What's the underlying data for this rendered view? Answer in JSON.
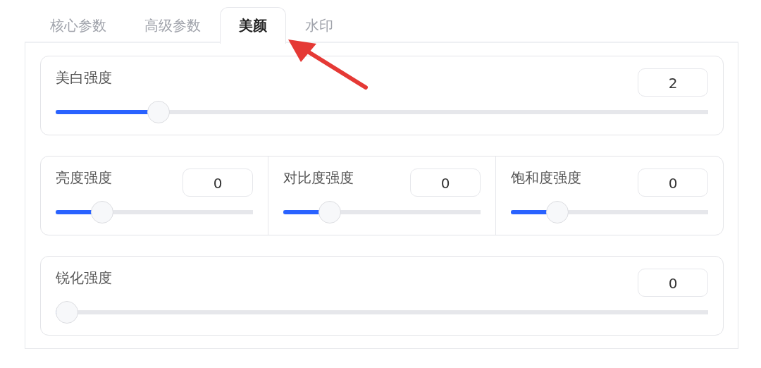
{
  "tabs": [
    {
      "label": "核心参数",
      "selected": false
    },
    {
      "label": "高级参数",
      "selected": false
    },
    {
      "label": "美颜",
      "selected": true
    },
    {
      "label": "水印",
      "selected": false
    }
  ],
  "cards": [
    {
      "sliders": [
        {
          "label": "美白强度",
          "value": "2",
          "level": 0.145
        }
      ]
    },
    {
      "sliders": [
        {
          "label": "亮度强度",
          "value": "0",
          "level": 0.2
        },
        {
          "label": "对比度强度",
          "value": "0",
          "level": 0.2
        },
        {
          "label": "饱和度强度",
          "value": "0",
          "level": 0.2
        }
      ]
    },
    {
      "sliders": [
        {
          "label": "锐化强度",
          "value": "0",
          "level": 0
        }
      ]
    }
  ]
}
